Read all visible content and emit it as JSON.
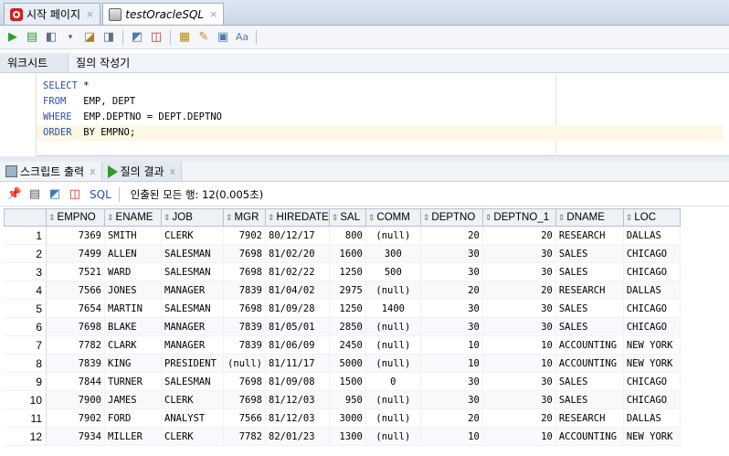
{
  "doc_tabs": [
    {
      "label": "시작 페이지",
      "active": false
    },
    {
      "label": "testOracleSQL",
      "active": true
    }
  ],
  "worksheet_tabs": [
    "워크시트",
    "질의 작성기"
  ],
  "editor": {
    "lines": [
      {
        "kw": "SELECT",
        "rest": " *"
      },
      {
        "kw": "FROM",
        "rest": "   EMP, DEPT"
      },
      {
        "kw": "WHERE",
        "rest": "  EMP.DEPTNO = DEPT.DEPTNO"
      },
      {
        "kw": "ORDER",
        "rest": "  BY EMPNO;"
      }
    ]
  },
  "result_tabs": [
    {
      "label": "스크립트 출력",
      "close": "x"
    },
    {
      "label": "질의 결과",
      "close": "x"
    }
  ],
  "result_toolbar": {
    "sql_label": "SQL",
    "status": "인출된 모든 행: 12(0.005초)"
  },
  "grid": {
    "columns": [
      "EMPNO",
      "ENAME",
      "JOB",
      "MGR",
      "HIREDATE",
      "SAL",
      "COMM",
      "DEPTNO",
      "DEPTNO_1",
      "DNAME",
      "LOC"
    ],
    "rows": [
      [
        "1",
        "7369",
        "SMITH",
        "CLERK",
        "7902",
        "80/12/17",
        "800",
        "(null)",
        "20",
        "20",
        "RESEARCH",
        "DALLAS"
      ],
      [
        "2",
        "7499",
        "ALLEN",
        "SALESMAN",
        "7698",
        "81/02/20",
        "1600",
        "300",
        "30",
        "30",
        "SALES",
        "CHICAGO"
      ],
      [
        "3",
        "7521",
        "WARD",
        "SALESMAN",
        "7698",
        "81/02/22",
        "1250",
        "500",
        "30",
        "30",
        "SALES",
        "CHICAGO"
      ],
      [
        "4",
        "7566",
        "JONES",
        "MANAGER",
        "7839",
        "81/04/02",
        "2975",
        "(null)",
        "20",
        "20",
        "RESEARCH",
        "DALLAS"
      ],
      [
        "5",
        "7654",
        "MARTIN",
        "SALESMAN",
        "7698",
        "81/09/28",
        "1250",
        "1400",
        "30",
        "30",
        "SALES",
        "CHICAGO"
      ],
      [
        "6",
        "7698",
        "BLAKE",
        "MANAGER",
        "7839",
        "81/05/01",
        "2850",
        "(null)",
        "30",
        "30",
        "SALES",
        "CHICAGO"
      ],
      [
        "7",
        "7782",
        "CLARK",
        "MANAGER",
        "7839",
        "81/06/09",
        "2450",
        "(null)",
        "10",
        "10",
        "ACCOUNTING",
        "NEW YORK"
      ],
      [
        "8",
        "7839",
        "KING",
        "PRESIDENT",
        "(null)",
        "81/11/17",
        "5000",
        "(null)",
        "10",
        "10",
        "ACCOUNTING",
        "NEW YORK"
      ],
      [
        "9",
        "7844",
        "TURNER",
        "SALESMAN",
        "7698",
        "81/09/08",
        "1500",
        "0",
        "30",
        "30",
        "SALES",
        "CHICAGO"
      ],
      [
        "10",
        "7900",
        "JAMES",
        "CLERK",
        "7698",
        "81/12/03",
        "950",
        "(null)",
        "30",
        "30",
        "SALES",
        "CHICAGO"
      ],
      [
        "11",
        "7902",
        "FORD",
        "ANALYST",
        "7566",
        "81/12/03",
        "3000",
        "(null)",
        "20",
        "20",
        "RESEARCH",
        "DALLAS"
      ],
      [
        "12",
        "7934",
        "MILLER",
        "CLERK",
        "7782",
        "82/01/23",
        "1300",
        "(null)",
        "10",
        "10",
        "ACCOUNTING",
        "NEW YORK"
      ]
    ]
  }
}
